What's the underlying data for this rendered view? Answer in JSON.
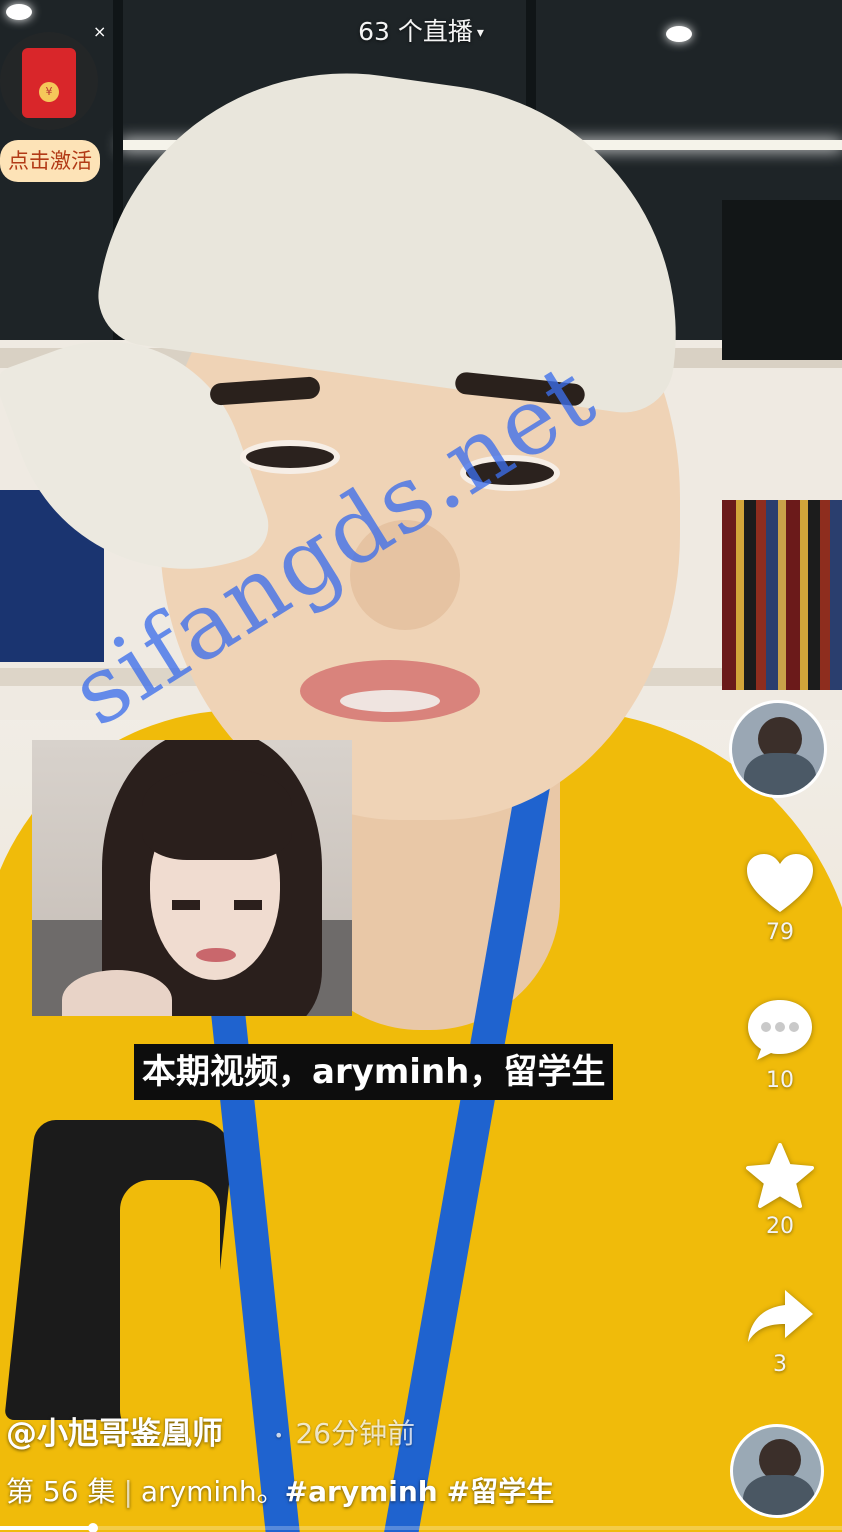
{
  "header": {
    "live_count_label": "63 个直播"
  },
  "red_packet": {
    "activate_label": "点击激活",
    "close_glyph": "×"
  },
  "watermark": {
    "text": "sifangds.net"
  },
  "subtitle": {
    "text": "本期视频，aryminh，留学生"
  },
  "actions": {
    "like": {
      "icon": "heart-icon",
      "count": "79"
    },
    "comment": {
      "icon": "comment-icon",
      "count": "10"
    },
    "favorite": {
      "icon": "star-icon",
      "count": "20"
    },
    "share": {
      "icon": "share-icon",
      "count": "3"
    }
  },
  "post": {
    "author": "@小旭哥鉴凰师",
    "time": "26分钟前",
    "episode": "第 56 集",
    "description": "aryminh。",
    "hashtags": [
      "#aryminh",
      "#留学生"
    ]
  },
  "playback": {
    "progress": 0.11
  },
  "colors": {
    "accent_yellow": "#f0bb0a",
    "lanyard_blue": "#1f63cf",
    "activate_bg": "#fde3b7",
    "red_packet": "#d9262a"
  }
}
